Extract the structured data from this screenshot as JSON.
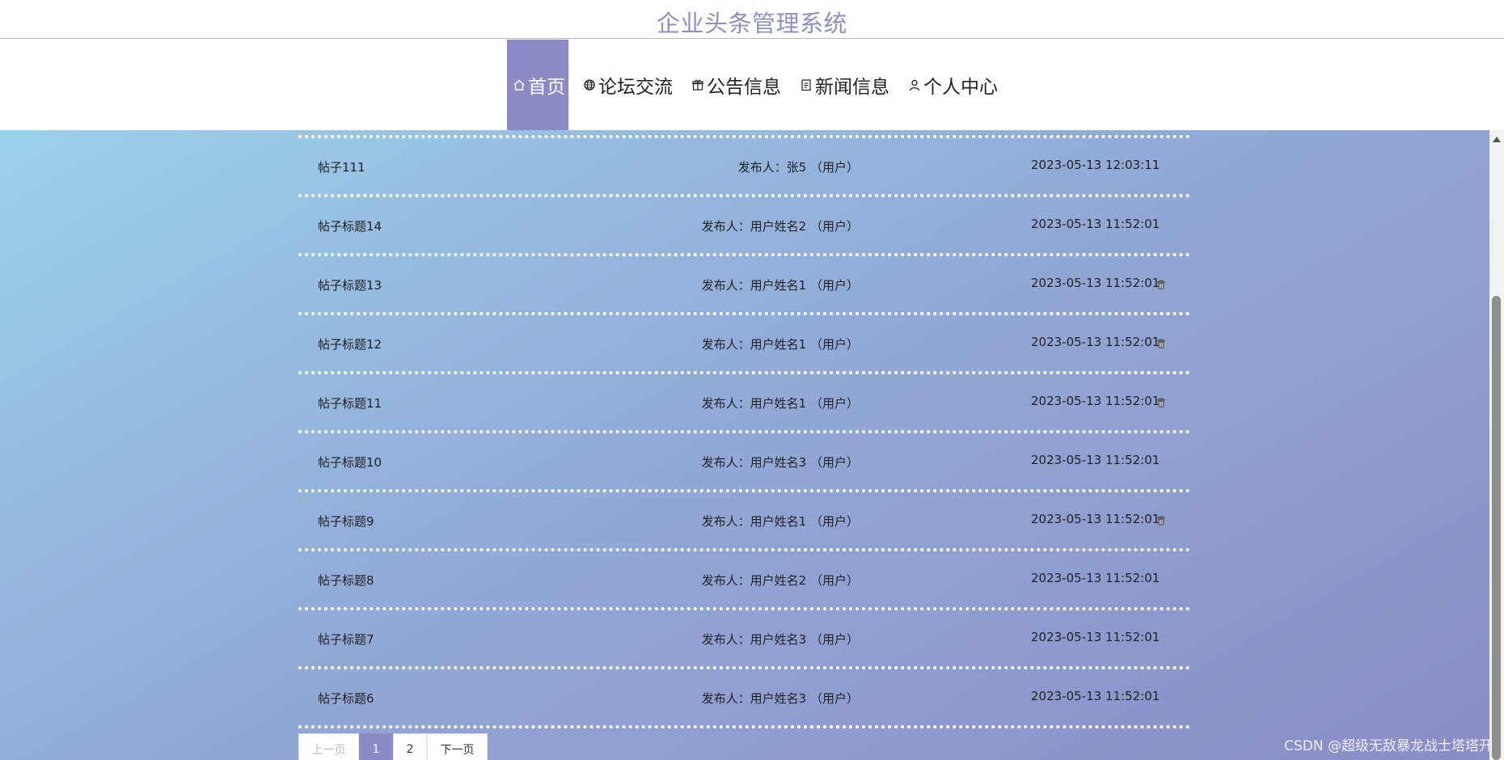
{
  "header": {
    "title": "企业头条管理系统"
  },
  "nav": {
    "items": [
      {
        "label": "首页",
        "icon": "home-icon"
      },
      {
        "label": "论坛交流",
        "icon": "globe-icon"
      },
      {
        "label": "公告信息",
        "icon": "gift-icon"
      },
      {
        "label": "新闻信息",
        "icon": "document-icon"
      },
      {
        "label": "个人中心",
        "icon": "user-icon"
      }
    ],
    "active": "首页"
  },
  "posts": [
    {
      "title": "帖子111",
      "poster": "发布人：张5 （用户）",
      "date": "2023-05-13 12:03:11",
      "deletable": false
    },
    {
      "title": "帖子标题14",
      "poster": "发布人：用户姓名2 （用户）",
      "date": "2023-05-13 11:52:01",
      "deletable": false
    },
    {
      "title": "帖子标题13",
      "poster": "发布人：用户姓名1 （用户）",
      "date": "2023-05-13 11:52:01",
      "deletable": true
    },
    {
      "title": "帖子标题12",
      "poster": "发布人：用户姓名1 （用户）",
      "date": "2023-05-13 11:52:01",
      "deletable": true
    },
    {
      "title": "帖子标题11",
      "poster": "发布人：用户姓名1 （用户）",
      "date": "2023-05-13 11:52:01",
      "deletable": true
    },
    {
      "title": "帖子标题10",
      "poster": "发布人：用户姓名3 （用户）",
      "date": "2023-05-13 11:52:01",
      "deletable": false
    },
    {
      "title": "帖子标题9",
      "poster": "发布人：用户姓名1 （用户）",
      "date": "2023-05-13 11:52:01",
      "deletable": true
    },
    {
      "title": "帖子标题8",
      "poster": "发布人：用户姓名2 （用户）",
      "date": "2023-05-13 11:52:01",
      "deletable": false
    },
    {
      "title": "帖子标题7",
      "poster": "发布人：用户姓名3 （用户）",
      "date": "2023-05-13 11:52:01",
      "deletable": false
    },
    {
      "title": "帖子标题6",
      "poster": "发布人：用户姓名3 （用户）",
      "date": "2023-05-13 11:52:01",
      "deletable": false
    }
  ],
  "pager": {
    "prev": "上一页",
    "pages": [
      "1",
      "2"
    ],
    "current": "1",
    "next": "下一页"
  },
  "watermark": "CSDN @超级无敌暴龙战士塔塔开",
  "colors": {
    "accent": "#8b8bc6",
    "title": "#8f8fc7",
    "bg_start": "#9bd1ea",
    "bg_end": "#8a8dc6"
  }
}
